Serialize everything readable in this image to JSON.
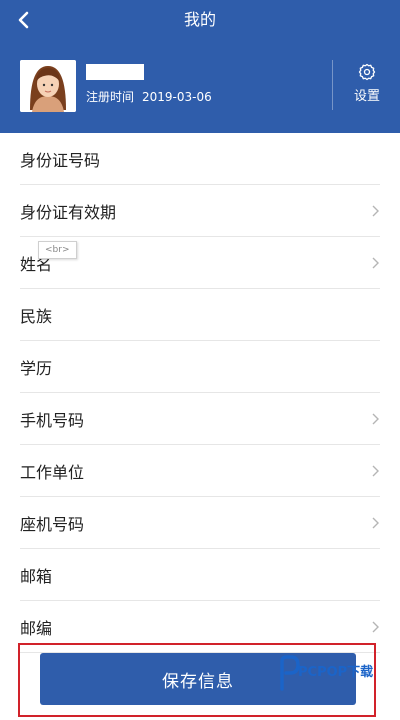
{
  "header": {
    "title": "我的",
    "back_icon": "chevron-left-icon",
    "user": {
      "registered_label": "注册时间",
      "registered_date": "2019-03-06"
    },
    "settings": {
      "label": "设置",
      "icon": "gear-icon"
    },
    "background_color": "#2f5dab"
  },
  "tooltip_tag": "<br>",
  "list": {
    "items": [
      {
        "label": "身份证号码",
        "has_chevron": false
      },
      {
        "label": "身份证有效期",
        "has_chevron": true
      },
      {
        "label": "姓名",
        "has_chevron": true
      },
      {
        "label": "民族",
        "has_chevron": false
      },
      {
        "label": "学历",
        "has_chevron": false
      },
      {
        "label": "手机号码",
        "has_chevron": true
      },
      {
        "label": "工作单位",
        "has_chevron": true
      },
      {
        "label": "座机号码",
        "has_chevron": true
      },
      {
        "label": "邮箱",
        "has_chevron": false
      },
      {
        "label": "邮编",
        "has_chevron": true
      }
    ]
  },
  "save_button": {
    "label": "保存信息"
  },
  "watermark": {
    "text": "PCPOP下载"
  },
  "colors": {
    "accent": "#2f5dab",
    "highlight_border": "#d1222a"
  }
}
